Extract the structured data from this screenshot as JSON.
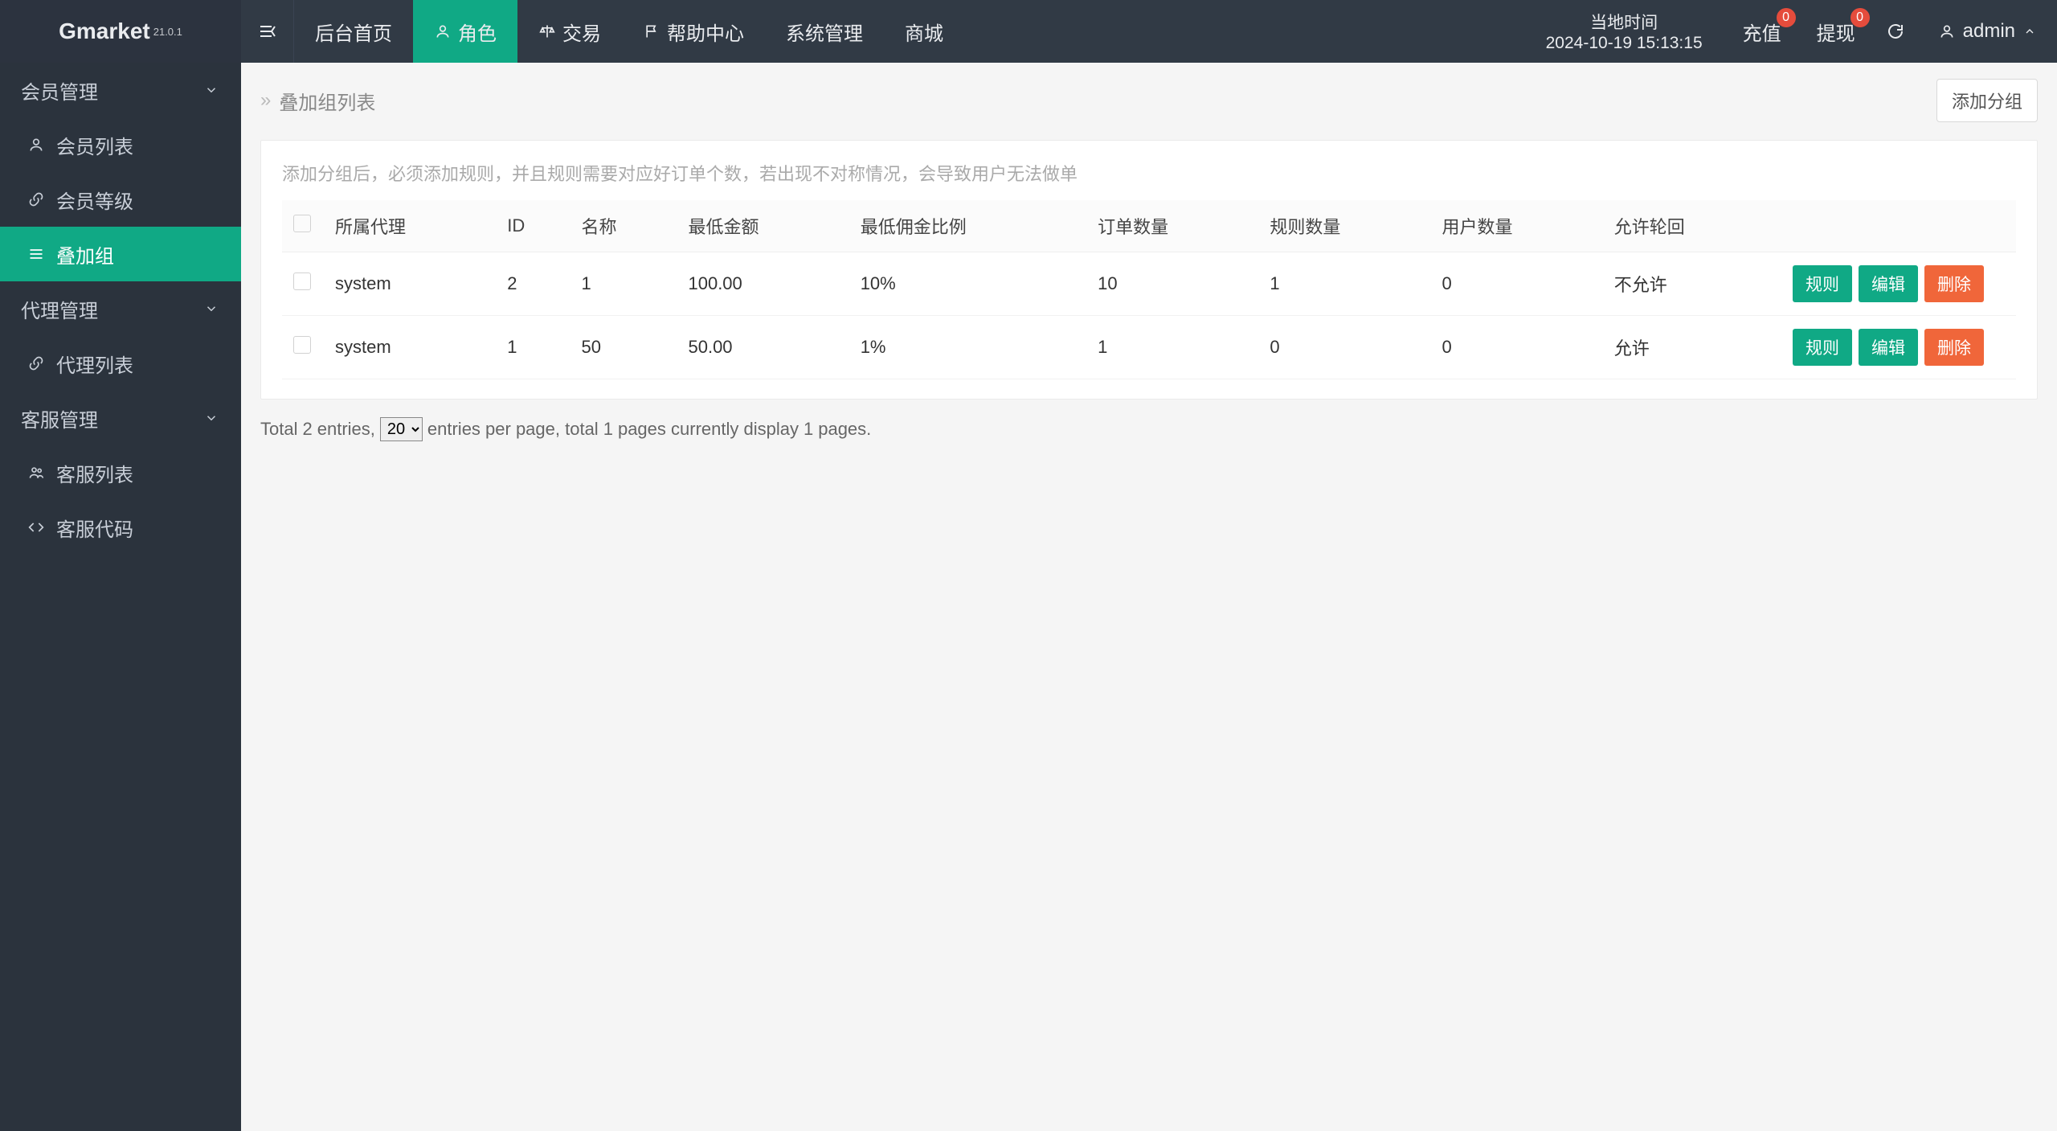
{
  "brand": {
    "name": "Gmarket",
    "version": "21.0.1"
  },
  "topnav": {
    "items": [
      {
        "id": "home",
        "label": "后台首页",
        "icon": "none"
      },
      {
        "id": "role",
        "label": "角色",
        "icon": "user",
        "active": true
      },
      {
        "id": "trade",
        "label": "交易",
        "icon": "scale"
      },
      {
        "id": "help",
        "label": "帮助中心",
        "icon": "flag"
      },
      {
        "id": "sys",
        "label": "系统管理",
        "icon": "none"
      },
      {
        "id": "mall",
        "label": "商城",
        "icon": "none"
      }
    ],
    "time_label": "当地时间",
    "time_value": "2024-10-19 15:13:15",
    "recharge": {
      "label": "充值",
      "badge": "0"
    },
    "withdraw": {
      "label": "提现",
      "badge": "0"
    },
    "user": "admin"
  },
  "sidebar": {
    "groups": [
      {
        "label": "会员管理",
        "items": [
          {
            "id": "member-list",
            "icon": "user",
            "label": "会员列表"
          },
          {
            "id": "member-level",
            "icon": "link",
            "label": "会员等级"
          },
          {
            "id": "stack-group",
            "icon": "menu",
            "label": "叠加组",
            "active": true
          }
        ]
      },
      {
        "label": "代理管理",
        "items": [
          {
            "id": "agent-list",
            "icon": "link",
            "label": "代理列表"
          }
        ]
      },
      {
        "label": "客服管理",
        "items": [
          {
            "id": "cs-list",
            "icon": "users",
            "label": "客服列表"
          },
          {
            "id": "cs-code",
            "icon": "code",
            "label": "客服代码"
          }
        ]
      }
    ]
  },
  "page": {
    "breadcrumb": "叠加组列表",
    "add_btn": "添加分组",
    "hint": "添加分组后，必须添加规则，并且规则需要对应好订单个数，若出现不对称情况，会导致用户无法做单",
    "columns": [
      "所属代理",
      "ID",
      "名称",
      "最低金额",
      "最低佣金比例",
      "订单数量",
      "规则数量",
      "用户数量",
      "允许轮回"
    ],
    "rows": [
      {
        "agent": "system",
        "id": "2",
        "name": "1",
        "min_amount": "100.00",
        "min_rate": "10%",
        "orders": "10",
        "rules": "1",
        "users": "0",
        "loop": "不允许"
      },
      {
        "agent": "system",
        "id": "1",
        "name": "50",
        "min_amount": "50.00",
        "min_rate": "1%",
        "orders": "1",
        "rules": "0",
        "users": "0",
        "loop": "允许"
      }
    ],
    "row_actions": {
      "rule": "规则",
      "edit": "编辑",
      "delete": "删除"
    },
    "pager": {
      "prefix": "Total",
      "total": "2",
      "after_total": " entries,",
      "per_page_value": "20",
      "per_page_suffix": " entries per page, total",
      "pages": "1",
      "mid": " pages currently display",
      "current_page": "1",
      "suffix": " pages."
    }
  }
}
